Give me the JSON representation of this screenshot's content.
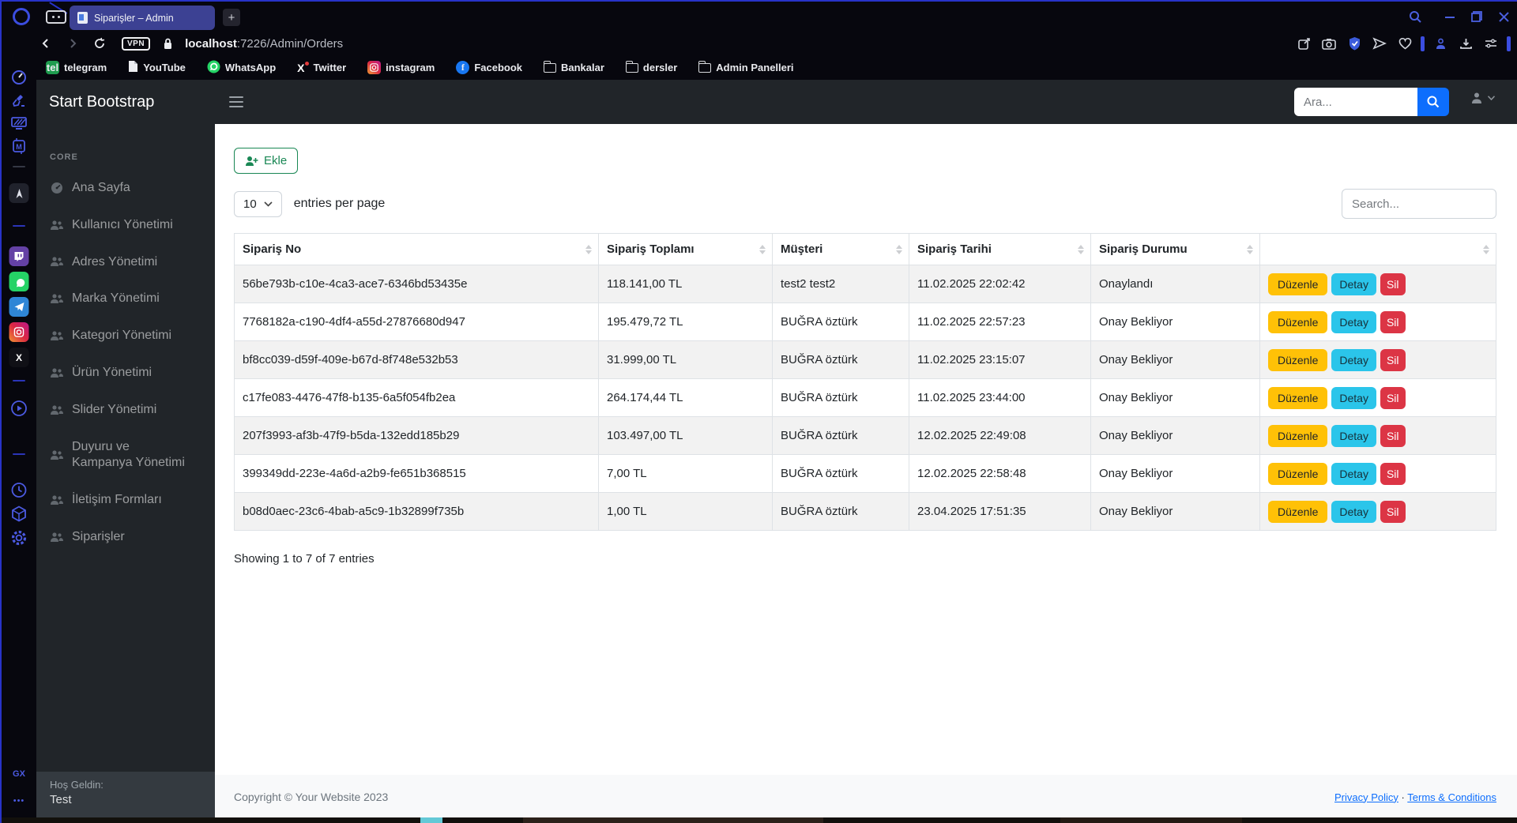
{
  "browser": {
    "tab": {
      "title": "Siparişler – Admin"
    },
    "address": {
      "vpn": "VPN",
      "host": "localhost",
      "path": ":7226/Admin/Orders"
    },
    "bookmarks": [
      {
        "label": "telegram",
        "glyph": "tel"
      },
      {
        "label": "YouTube"
      },
      {
        "label": "WhatsApp"
      },
      {
        "label": "Twitter",
        "glyph": "X"
      },
      {
        "label": "instagram"
      },
      {
        "label": "Facebook",
        "glyph": "f"
      },
      {
        "label": "Bankalar"
      },
      {
        "label": "dersler"
      },
      {
        "label": "Admin Panelleri"
      }
    ],
    "rail": {
      "mods_glyph": "M",
      "x_glyph": "X",
      "gx": "GX",
      "more": "•••"
    }
  },
  "admin": {
    "brand": "Start Bootstrap",
    "topbar": {
      "search_placeholder": "Ara..."
    },
    "sidebar": {
      "section": "CORE",
      "items": [
        {
          "label": "Ana Sayfa"
        },
        {
          "label": "Kullanıcı Yönetimi"
        },
        {
          "label": "Adres Yönetimi"
        },
        {
          "label": "Marka Yönetimi"
        },
        {
          "label": "Kategori Yönetimi"
        },
        {
          "label": "Ürün Yönetimi"
        },
        {
          "label": "Slider Yönetimi"
        },
        {
          "label": "Duyuru ve Kampanya Yönetimi"
        },
        {
          "label": "İletişim Formları"
        },
        {
          "label": "Siparişler"
        }
      ],
      "footer_heading": "Hoş Geldin:",
      "footer_user": "Test"
    },
    "toolbar": {
      "add_label": "Ekle",
      "page_size": "10",
      "entries_label": "entries per page",
      "search_placeholder": "Search..."
    },
    "table": {
      "columns": [
        "Sipariş No",
        "Sipariş Toplamı",
        "Müşteri",
        "Sipariş Tarihi",
        "Sipariş Durumu"
      ],
      "actions": {
        "edit": "Düzenle",
        "detail": "Detay",
        "delete": "Sil"
      },
      "rows": [
        {
          "no": "56be793b-c10e-4ca3-ace7-6346bd53435e",
          "total": "118.141,00 TL",
          "customer": "test2 test2",
          "date": "11.02.2025 22:02:42",
          "status": "Onaylandı"
        },
        {
          "no": "7768182a-c190-4df4-a55d-27876680d947",
          "total": "195.479,72 TL",
          "customer": "BUĞRA öztürk",
          "date": "11.02.2025 22:57:23",
          "status": "Onay Bekliyor"
        },
        {
          "no": "bf8cc039-d59f-409e-b67d-8f748e532b53",
          "total": "31.999,00 TL",
          "customer": "BUĞRA öztürk",
          "date": "11.02.2025 23:15:07",
          "status": "Onay Bekliyor"
        },
        {
          "no": "c17fe083-4476-47f8-b135-6a5f054fb2ea",
          "total": "264.174,44 TL",
          "customer": "BUĞRA öztürk",
          "date": "11.02.2025 23:44:00",
          "status": "Onay Bekliyor"
        },
        {
          "no": "207f3993-af3b-47f9-b5da-132edd185b29",
          "total": "103.497,00 TL",
          "customer": "BUĞRA öztürk",
          "date": "12.02.2025 22:49:08",
          "status": "Onay Bekliyor"
        },
        {
          "no": "399349dd-223e-4a6d-a2b9-fe651b368515",
          "total": "7,00 TL",
          "customer": "BUĞRA öztürk",
          "date": "12.02.2025 22:58:48",
          "status": "Onay Bekliyor"
        },
        {
          "no": "b08d0aec-23c6-4bab-a5c9-1b32899f735b",
          "total": "1,00 TL",
          "customer": "BUĞRA öztürk",
          "date": "23.04.2025 17:51:35",
          "status": "Onay Bekliyor"
        }
      ]
    },
    "info": "Showing 1 to 7 of 7 entries",
    "footer": {
      "copyright": "Copyright © Your Website 2023",
      "privacy": "Privacy Policy",
      "separator": "·",
      "terms": "Terms & Conditions"
    },
    "colors": {
      "accent": "#0d6efd",
      "success": "#198754",
      "warning": "#ffc107",
      "info": "#2bc5ea",
      "danger": "#dc3545",
      "dark": "#212529"
    }
  }
}
